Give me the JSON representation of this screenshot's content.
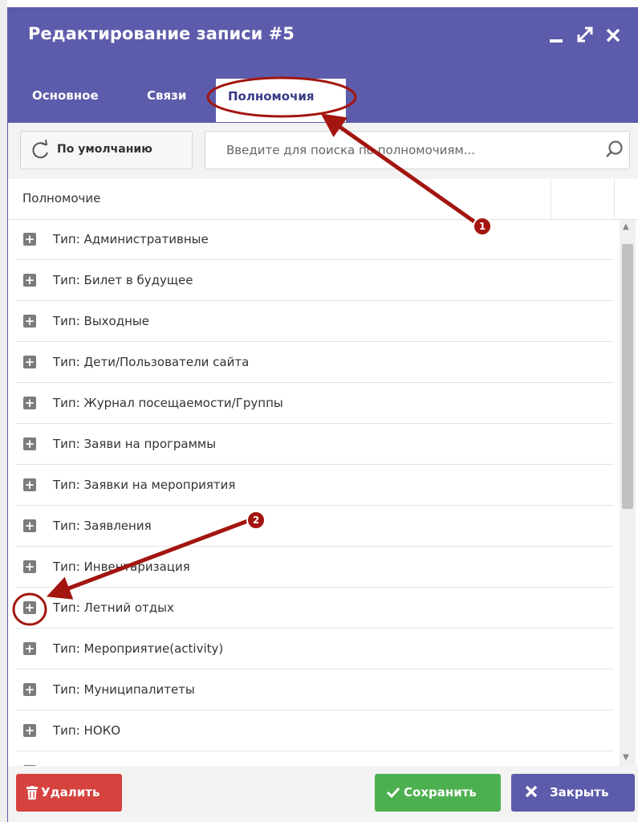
{
  "dialog": {
    "title": "Редактирование записи #5",
    "window_controls": [
      "minimize-icon",
      "maximize-icon",
      "close-icon"
    ],
    "tabs": [
      {
        "label": "Основное",
        "active": false
      },
      {
        "label": "Связи",
        "active": false
      },
      {
        "label": "Полномочия",
        "active": true
      }
    ]
  },
  "toolbar": {
    "default_label": "По умолчанию",
    "default_icon": "refresh-icon",
    "search_placeholder": "Введите для поиска по полномочиям...",
    "search_icon": "search-icon"
  },
  "table": {
    "header": "Полномочие",
    "rows": [
      "Тип: Административные",
      "Тип: Билет в будущее",
      "Тип: Выходные",
      "Тип: Дети/Пользователи сайта",
      "Тип: Журнал посещаемости/Группы",
      "Тип: Заяви на программы",
      "Тип: Заявки на мероприятия",
      "Тип: Заявления",
      "Тип: Инвентаризация",
      "Тип: Летний отдых",
      "Тип: Мероприятие(activity)",
      "Тип: Муниципалитеты",
      "Тип: НОКО"
    ]
  },
  "footer": {
    "delete_label": "Удалить",
    "save_label": "Сохранить",
    "close_label": "Закрыть"
  },
  "annotations": {
    "badge1": "1",
    "badge2": "2"
  },
  "colors": {
    "header_bg": "#5d5bab",
    "delete_bg": "#d6423e",
    "save_bg": "#4db050",
    "close_bg": "#5d5bab",
    "annotation": "#a3150f"
  }
}
